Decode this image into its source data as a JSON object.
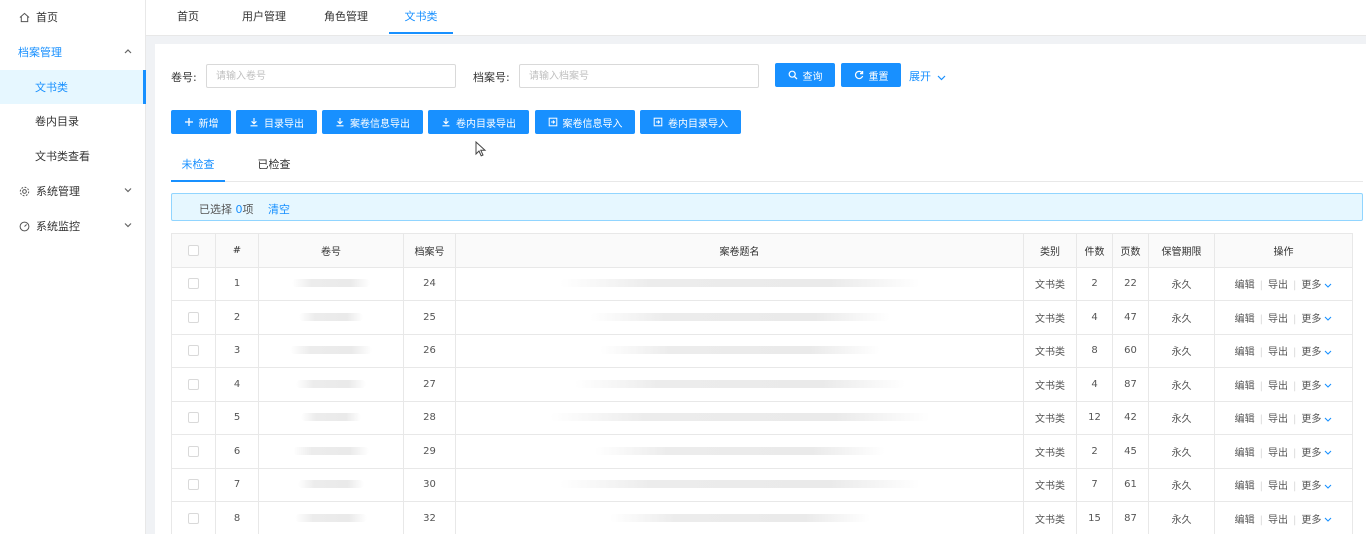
{
  "sidebar": {
    "items": [
      {
        "label": "首页",
        "icon": "home-icon"
      },
      {
        "label": "档案管理"
      },
      {
        "label": "文书类"
      },
      {
        "label": "卷内目录"
      },
      {
        "label": "文书类查看"
      },
      {
        "label": "系统管理",
        "icon": "gear-icon"
      },
      {
        "label": "系统监控",
        "icon": "dashboard-icon"
      }
    ]
  },
  "tabs": [
    {
      "label": "首页"
    },
    {
      "label": "用户管理"
    },
    {
      "label": "角色管理"
    },
    {
      "label": "文书类"
    }
  ],
  "search": {
    "volume_label": "卷号:",
    "volume_placeholder": "请输入卷号",
    "archive_label": "档案号:",
    "archive_placeholder": "请输入档案号",
    "query_label": "查询",
    "reset_label": "重置",
    "expand_label": "展开"
  },
  "toolbar": {
    "add": "新增",
    "export_catalog": "目录导出",
    "export_case_info": "案卷信息导出",
    "export_inner_catalog": "卷内目录导出",
    "import_case_info": "案卷信息导入",
    "import_inner_catalog": "卷内目录导入"
  },
  "subtabs": {
    "unchecked": "未检查",
    "checked": "已检查"
  },
  "selection": {
    "prefix": "已选择",
    "count": "0",
    "suffix": "项",
    "clear": "清空"
  },
  "table": {
    "columns": {
      "index": "#",
      "volume": "卷号",
      "archive": "档案号",
      "title": "案卷题名",
      "category": "类别",
      "items": "件数",
      "pages": "页数",
      "retention": "保管期限",
      "actions": "操作"
    },
    "rows": [
      {
        "index": "1",
        "archive": "24",
        "category": "文书类",
        "items": "2",
        "pages": "22",
        "retention": "永久"
      },
      {
        "index": "2",
        "archive": "25",
        "category": "文书类",
        "items": "4",
        "pages": "47",
        "retention": "永久"
      },
      {
        "index": "3",
        "archive": "26",
        "category": "文书类",
        "items": "8",
        "pages": "60",
        "retention": "永久"
      },
      {
        "index": "4",
        "archive": "27",
        "category": "文书类",
        "items": "4",
        "pages": "87",
        "retention": "永久"
      },
      {
        "index": "5",
        "archive": "28",
        "category": "文书类",
        "items": "12",
        "pages": "42",
        "retention": "永久"
      },
      {
        "index": "6",
        "archive": "29",
        "category": "文书类",
        "items": "2",
        "pages": "45",
        "retention": "永久"
      },
      {
        "index": "7",
        "archive": "30",
        "category": "文书类",
        "items": "7",
        "pages": "61",
        "retention": "永久"
      },
      {
        "index": "8",
        "archive": "32",
        "category": "文书类",
        "items": "15",
        "pages": "87",
        "retention": "永久"
      }
    ],
    "row_actions": {
      "edit": "编辑",
      "export": "导出",
      "more": "更多"
    }
  },
  "colors": {
    "primary": "#1890ff",
    "active_bg": "#e6f7ff",
    "page_bg": "#f0f2f5"
  }
}
